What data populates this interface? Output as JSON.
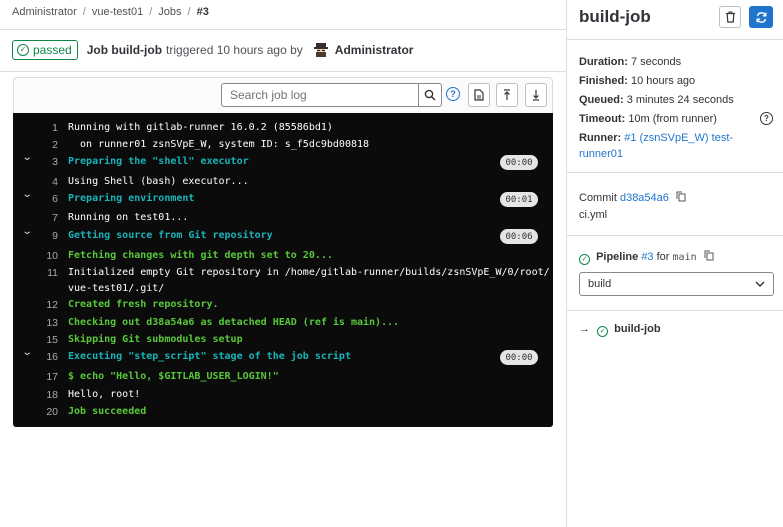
{
  "breadcrumb": {
    "items": [
      "Administrator",
      "vue-test01",
      "Jobs"
    ],
    "current": "#3",
    "separator": "/"
  },
  "job_header": {
    "status": "passed",
    "job_name": "Job build-job",
    "triggered_text": "triggered 10 hours ago by",
    "user": "Administrator"
  },
  "toolbar": {
    "search_placeholder": "Search job log",
    "help_glyph": "?"
  },
  "log": {
    "lines": [
      {
        "num": "1",
        "text": "Running with gitlab-runner 16.0.2 (85586bd1)",
        "style": "white",
        "section": false
      },
      {
        "num": "2",
        "text": "  on runner01 zsnSVpE_W, system ID: s_f5dc9bd00818",
        "style": "white",
        "section": false
      },
      {
        "num": "3",
        "text": "Preparing the \"shell\" executor",
        "style": "cyan",
        "section": true,
        "duration": "00:00"
      },
      {
        "num": "4",
        "text": "Using Shell (bash) executor...",
        "style": "white",
        "section": false
      },
      {
        "num": "6",
        "text": "Preparing environment",
        "style": "cyan",
        "section": true,
        "duration": "00:01"
      },
      {
        "num": "7",
        "text": "Running on test01...",
        "style": "white",
        "section": false
      },
      {
        "num": "9",
        "text": "Getting source from Git repository",
        "style": "cyan",
        "section": true,
        "duration": "00:06"
      },
      {
        "num": "10",
        "text": "Fetching changes with git depth set to 20...",
        "style": "green",
        "section": false
      },
      {
        "num": "11",
        "text": "Initialized empty Git repository in /home/gitlab-runner/builds/zsnSVpE_W/0/root/",
        "style": "white",
        "section": false
      },
      {
        "num": "",
        "text": "vue-test01/.git/",
        "style": "white",
        "section": false
      },
      {
        "num": "12",
        "text": "Created fresh repository.",
        "style": "green",
        "section": false
      },
      {
        "num": "13",
        "text": "Checking out d38a54a6 as detached HEAD (ref is main)...",
        "style": "green",
        "section": false
      },
      {
        "num": "15",
        "text": "Skipping Git submodules setup",
        "style": "green",
        "section": false
      },
      {
        "num": "16",
        "text": "Executing \"step_script\" stage of the job script",
        "style": "cyan",
        "section": true,
        "duration": "00:00"
      },
      {
        "num": "17",
        "text": "$ echo \"Hello, $GITLAB_USER_LOGIN!\"",
        "style": "green",
        "section": false
      },
      {
        "num": "18",
        "text": "Hello, root!",
        "style": "white",
        "section": false
      },
      {
        "num": "20",
        "text": "Job succeeded",
        "style": "green",
        "section": false
      }
    ]
  },
  "sidebar": {
    "title": "build-job",
    "duration_label": "Duration:",
    "duration_value": "7 seconds",
    "finished_label": "Finished:",
    "finished_value": "10 hours ago",
    "queued_label": "Queued:",
    "queued_value": "3 minutes 24 seconds",
    "timeout_label": "Timeout:",
    "timeout_value": "10m (from runner)",
    "runner_label": "Runner:",
    "runner_link_1": "#1 (zsnSVpE_W) test-",
    "runner_link_2": "runner01",
    "commit_label": "Commit",
    "commit_sha": "d38a54a6",
    "commit_message": "ci.yml",
    "pipeline_label": "Pipeline",
    "pipeline_id": "#3",
    "pipeline_for": "for",
    "pipeline_ref": "main",
    "stage_selected": "build",
    "job_arrow": "→",
    "job_item": "build-job"
  },
  "colors": {
    "success": "#108548",
    "link": "#1f75cb",
    "log_bg": "#0b0b0b",
    "log_cyan": "#18b4b9",
    "log_green": "#58c83b"
  }
}
